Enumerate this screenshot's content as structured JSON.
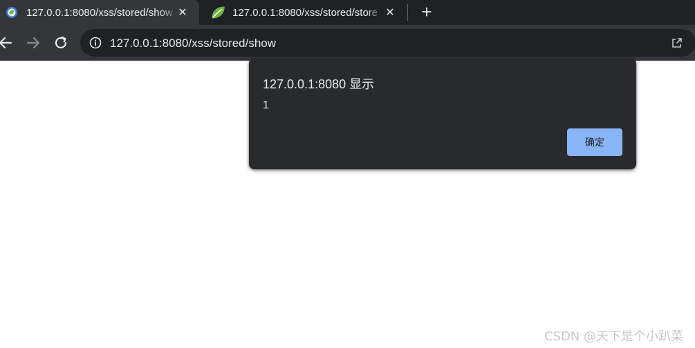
{
  "browser": {
    "tabs": [
      {
        "title": "127.0.0.1:8080/xss/stored/show",
        "favicon": "spring-boot-logo-icon",
        "active": true
      },
      {
        "title": "127.0.0.1:8080/xss/stored/store",
        "favicon": "spring-leaf-icon",
        "active": false
      }
    ],
    "new_tab_icon": "plus-icon",
    "address_bar": {
      "url": "127.0.0.1:8080/xss/stored/show"
    }
  },
  "dialog": {
    "title": "127.0.0.1:8080 显示",
    "message": "1",
    "ok_label": "确定"
  },
  "watermark": "CSDN @天下是个小趴菜",
  "colors": {
    "tabstrip": "#202124",
    "toolbar": "#35363a",
    "dialog_bg": "#292a2d",
    "accent": "#8ab4f8",
    "spring_green": "#6db33f"
  }
}
